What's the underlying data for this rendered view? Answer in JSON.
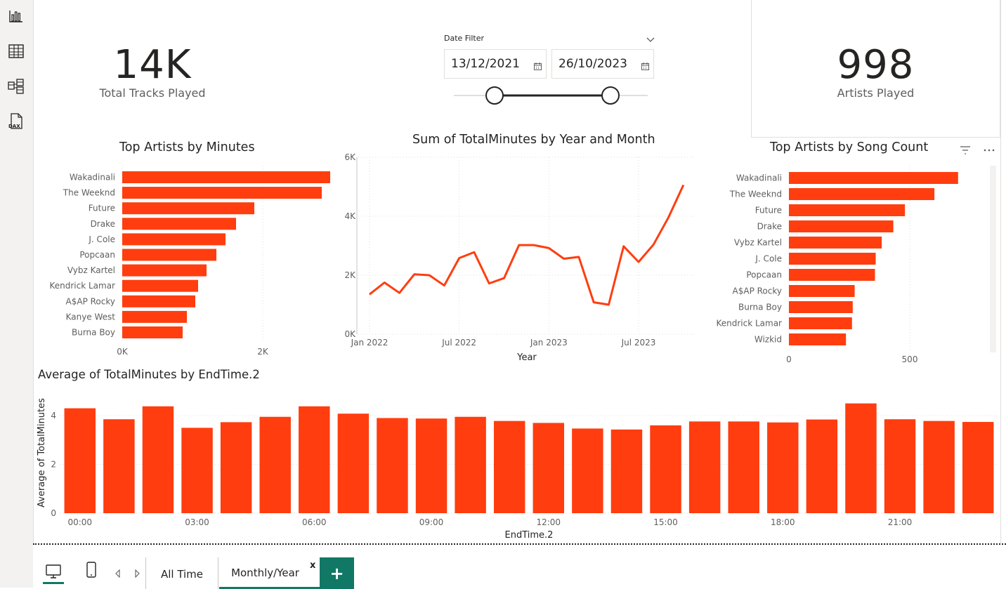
{
  "rail": {
    "icons": [
      "report-view-icon",
      "table-view-icon",
      "model-view-icon",
      "dax-query-icon"
    ],
    "dax_label": "DAX"
  },
  "cards": {
    "tracks": {
      "value": "14K",
      "label": "Total Tracks Played"
    },
    "artists": {
      "value": "998",
      "label": "Artists Played"
    }
  },
  "date_filter": {
    "title": "Date Filter",
    "start": "13/12/2021",
    "end": "26/10/2023"
  },
  "charts": {
    "minutes": {
      "title": "Top Artists by Minutes",
      "type": "bar",
      "categories": [
        "Wakadinali",
        "The Weeknd",
        "Future",
        "Drake",
        "J. Cole",
        "Popcaan",
        "Vybz Kartel",
        "Kendrick Lamar",
        "A$AP Rocky",
        "Kanye West",
        "Burna Boy"
      ],
      "values": [
        2960,
        2840,
        1880,
        1620,
        1470,
        1340,
        1200,
        1080,
        1040,
        920,
        860
      ],
      "xticks": [
        "0K",
        "2K"
      ],
      "xtick_values": [
        0,
        2000
      ],
      "color": "#ff3d0f"
    },
    "monthly": {
      "title": "Sum of TotalMinutes by Year and Month",
      "type": "line",
      "xlabel": "Year",
      "yticks": [
        "0K",
        "2K",
        "4K",
        "6K"
      ],
      "ytick_values": [
        0,
        2000,
        4000,
        6000
      ],
      "xticks": [
        "Jan 2022",
        "Jul 2022",
        "Jan 2023",
        "Jul 2023"
      ],
      "xtick_dates": [
        "2022-01",
        "2022-07",
        "2023-01",
        "2023-07"
      ],
      "x": [
        "2021-12",
        "2022-01",
        "2022-02",
        "2022-03",
        "2022-04",
        "2022-05",
        "2022-06",
        "2022-07",
        "2022-08",
        "2022-09",
        "2022-10",
        "2022-11",
        "2022-12",
        "2023-01",
        "2023-02",
        "2023-03",
        "2023-04",
        "2023-05",
        "2023-06",
        "2023-07",
        "2023-08",
        "2023-09",
        "2023-10"
      ],
      "values": [
        1350,
        1750,
        1400,
        2030,
        2000,
        1650,
        2580,
        2780,
        1720,
        1900,
        3020,
        3020,
        2920,
        2560,
        2620,
        1080,
        1000,
        2980,
        2450,
        3040,
        3960,
        5060
      ],
      "color": "#ff3d0f"
    },
    "songs": {
      "title": "Top Artists by Song Count",
      "type": "bar",
      "categories": [
        "Wakadinali",
        "The Weeknd",
        "Future",
        "Drake",
        "Vybz Kartel",
        "J. Cole",
        "Popcaan",
        "A$AP Rocky",
        "Burna Boy",
        "Kendrick Lamar",
        "Wizkid"
      ],
      "values": [
        700,
        602,
        480,
        432,
        384,
        359,
        356,
        272,
        264,
        261,
        236
      ],
      "xticks": [
        "0",
        "500"
      ],
      "xtick_values": [
        0,
        500
      ],
      "color": "#ff3d0f"
    },
    "hourly": {
      "title": "Average of TotalMinutes by EndTime.2",
      "type": "bar",
      "xlabel": "EndTime.2",
      "ylabel": "Average of TotalMinutes",
      "yticks": [
        "0",
        "2",
        "4"
      ],
      "ytick_values": [
        0,
        2,
        4
      ],
      "categories": [
        "00:00",
        "01:00",
        "02:00",
        "03:00",
        "04:00",
        "05:00",
        "06:00",
        "07:00",
        "08:00",
        "09:00",
        "10:00",
        "11:00",
        "12:00",
        "13:00",
        "14:00",
        "15:00",
        "16:00",
        "17:00",
        "18:00",
        "19:00",
        "20:00",
        "21:00",
        "22:00",
        "23:00"
      ],
      "xticks": [
        "00:00",
        "03:00",
        "06:00",
        "09:00",
        "12:00",
        "15:00",
        "18:00",
        "21:00"
      ],
      "values": [
        4.3,
        3.85,
        4.38,
        3.5,
        3.73,
        3.95,
        4.38,
        4.08,
        3.9,
        3.88,
        3.95,
        3.78,
        3.7,
        3.47,
        3.43,
        3.6,
        3.76,
        3.76,
        3.72,
        3.84,
        4.5,
        3.85,
        3.78,
        3.74
      ],
      "color": "#ff3d0f"
    }
  },
  "tabs": {
    "pages": [
      "All Time",
      "Monthly/Year"
    ],
    "active": "Monthly/Year",
    "close_label": "x",
    "add_label": "+"
  },
  "colors": {
    "accent": "#117865",
    "bar": "#ff3d0f"
  }
}
